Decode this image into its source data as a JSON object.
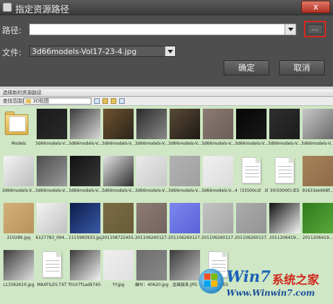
{
  "dialog": {
    "title": "指定资源路径",
    "close": "x",
    "path_label": "路径:",
    "path_value": "",
    "browse_label": "...",
    "file_label": "文件:",
    "file_value": "3d66models-Vol17-23-4.jpg",
    "ok": "确定",
    "cancel": "取消"
  },
  "browser": {
    "title": "选择新的资源路径",
    "look_in_label": "查找范围(I):",
    "look_in_value": "3D贴图",
    "tiles": [
      {
        "caption": "Models",
        "kind": "folder"
      },
      {
        "caption": "3d66models-V...",
        "kind": "img",
        "c1": "#1a1a1a",
        "c2": "#2a2a2a"
      },
      {
        "caption": "3d66models-V...",
        "kind": "img",
        "c1": "#3a3a3a",
        "c2": "#d8d8d8"
      },
      {
        "caption": "3d66models-V...",
        "kind": "img",
        "c1": "#6e5232",
        "c2": "#2b241a"
      },
      {
        "caption": "3d66models-V...",
        "kind": "img",
        "c1": "#2a2a2a",
        "c2": "#8a8a8a"
      },
      {
        "caption": "3d66models-V...",
        "kind": "img",
        "c1": "#5a4a36",
        "c2": "#1e1a14"
      },
      {
        "caption": "3d66models-V...",
        "kind": "img",
        "c1": "#8c7a74",
        "c2": "#6c5e58"
      },
      {
        "caption": "3d66models-V...",
        "kind": "img",
        "c1": "#050505",
        "c2": "#1a1a1a"
      },
      {
        "caption": "3d66models-V...",
        "kind": "img",
        "c1": "#2e2e2e",
        "c2": "#1c1c1c"
      },
      {
        "caption": "3d66models-V...",
        "kind": "img",
        "c1": "#c8c8c8",
        "c2": "#6a6a6a"
      },
      {
        "caption": "3d66models-V...",
        "kind": "img",
        "c1": "#f4f4f4",
        "c2": "#bcbcbc"
      },
      {
        "caption": "3d66models-V...",
        "kind": "img",
        "c1": "#4c4c4c",
        "c2": "#9a9a9a"
      },
      {
        "caption": "3d66models-V...",
        "kind": "img",
        "c1": "#101010",
        "c2": "#3a3a3a"
      },
      {
        "caption": "3d66models-V...",
        "kind": "img",
        "c1": "#e6e6e6",
        "c2": "#2e2e2e"
      },
      {
        "caption": "3d66models-V...",
        "kind": "img",
        "c1": "#eaeaea",
        "c2": "#c8c8c8"
      },
      {
        "caption": "3d66models-V...",
        "kind": "img",
        "c1": "#b2b2b2",
        "c2": "#a0a0a0"
      },
      {
        "caption": "3d66models-V...",
        "kind": "img",
        "c1": "#f0f0f0",
        "c2": "#dcdcdc"
      },
      {
        "caption": "4（33500cd）.IES",
        "kind": "doc"
      },
      {
        "caption": "30(50000).IES",
        "kind": "doc"
      },
      {
        "caption": "91633ek668f...",
        "kind": "img",
        "c1": "#a8835a",
        "c2": "#8e6c48"
      },
      {
        "caption": "210289.jpg",
        "kind": "img",
        "c1": "#d2b07a",
        "c2": "#b8925c"
      },
      {
        "caption": "6127783_094...",
        "kind": "img",
        "c1": "#f4f4f4",
        "c2": "#c0c0c0"
      },
      {
        "caption": "1115983933.jpg",
        "kind": "img",
        "c1": "#0c1c48",
        "c2": "#3a5aa8"
      },
      {
        "caption": "201108722455...",
        "kind": "img",
        "c1": "#7a6a44",
        "c2": "#6a5c3a"
      },
      {
        "caption": "201106260127...",
        "kind": "img",
        "c1": "#8c7a72",
        "c2": "#746460"
      },
      {
        "caption": "201106260127...",
        "kind": "img",
        "c1": "#7e86f0",
        "c2": "#5a62d8"
      },
      {
        "caption": "201106260127...",
        "kind": "img",
        "c1": "#c2c2c2",
        "c2": "#a6a6a6"
      },
      {
        "caption": "201106260127...",
        "kind": "img",
        "c1": "#ababab",
        "c2": "#949494"
      },
      {
        "caption": "2011206419...",
        "kind": "img",
        "c1": "#111111",
        "c2": "#f4f4f4"
      },
      {
        "caption": "2011206419...",
        "kind": "img",
        "c1": "#2f7a1c",
        "c2": "#5aa83a"
      },
      {
        "caption": "L13362610.jpg",
        "kind": "img",
        "c1": "#3a3a3a",
        "c2": "#e0e0e0"
      },
      {
        "caption": "MAXFILES.TXT",
        "kind": "doc"
      },
      {
        "caption": "f0107f1ad9740...",
        "kind": "img",
        "c1": "#3a3a3a",
        "c2": "#f2f2f2"
      },
      {
        "caption": "YY.jpg",
        "kind": "img",
        "c1": "#eeeeee",
        "c2": "#e0e0e0"
      },
      {
        "caption": "编号：40620.jpg",
        "kind": "img",
        "c1": "#6c6c6c",
        "c2": "#8a8a8a"
      },
      {
        "caption": "金属链条.JPG",
        "kind": "img",
        "c1": "#3a3a3a",
        "c2": "#bdbdbd"
      },
      {
        "caption": "漆花纹.IES",
        "kind": "doc"
      }
    ]
  },
  "watermark": {
    "brand": "Win7",
    "brand_suffix": "系统之家",
    "url": "Www.Winwin7.com"
  }
}
